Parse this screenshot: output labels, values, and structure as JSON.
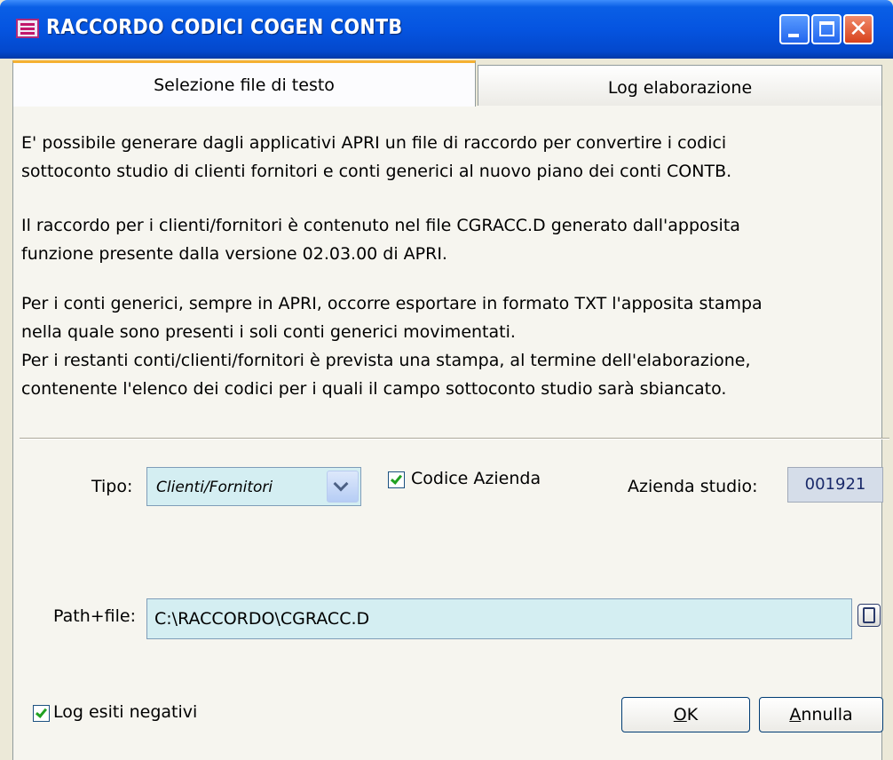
{
  "window": {
    "title": "RACCORDO CODICI COGEN CONTB",
    "icon": "app-list-icon",
    "controls": [
      "minimize-icon",
      "maximize-icon",
      "close-icon"
    ]
  },
  "tabs": [
    {
      "label": "Selezione file di testo",
      "active": true
    },
    {
      "label": "Log elaborazione",
      "active": false
    }
  ],
  "description": {
    "p1_line1": "E' possibile generare dagli applicativi APRI un file di raccordo per convertire i codici",
    "p1_line2": "sottoconto studio di clienti fornitori e conti generici al nuovo piano dei conti CONTB.",
    "p2_line1": "Il raccordo per i clienti/fornitori è contenuto nel file CGRACC.D generato dall'apposita",
    "p2_line2": "funzione presente dalla versione 02.03.00 di APRI.",
    "p3_line1": "Per i conti generici, sempre in APRI, occorre esportare in formato TXT l'apposita stampa",
    "p3_line2": "nella quale sono presenti i soli conti generici movimentati.",
    "p3_line3": "Per i restanti conti/clienti/fornitori è prevista una stampa, al termine dell'elaborazione,",
    "p3_line4": "contenente l'elenco dei codici per i quali il campo sottoconto studio sarà sbiancato."
  },
  "form": {
    "tipo_label": "Tipo:",
    "tipo_value": "Clienti/Fornitori",
    "codice_azienda_label": "Codice Azienda",
    "codice_azienda_checked": true,
    "azienda_studio_label": "Azienda studio:",
    "azienda_studio_value": "001921",
    "path_label": "Path+file:",
    "path_value": "C:\\RACCORDO\\CGRACC.D",
    "log_label": "Log esiti negativi",
    "log_checked": true
  },
  "buttons": {
    "ok_mnemonic": "O",
    "ok_rest": "K",
    "cancel_mnemonic": "A",
    "cancel_rest": "nnulla"
  },
  "colors": {
    "titlebar": "#0554e0",
    "tab_highlight": "#f5b133",
    "input_bg": "#d4eef2",
    "check": "#21a121"
  }
}
